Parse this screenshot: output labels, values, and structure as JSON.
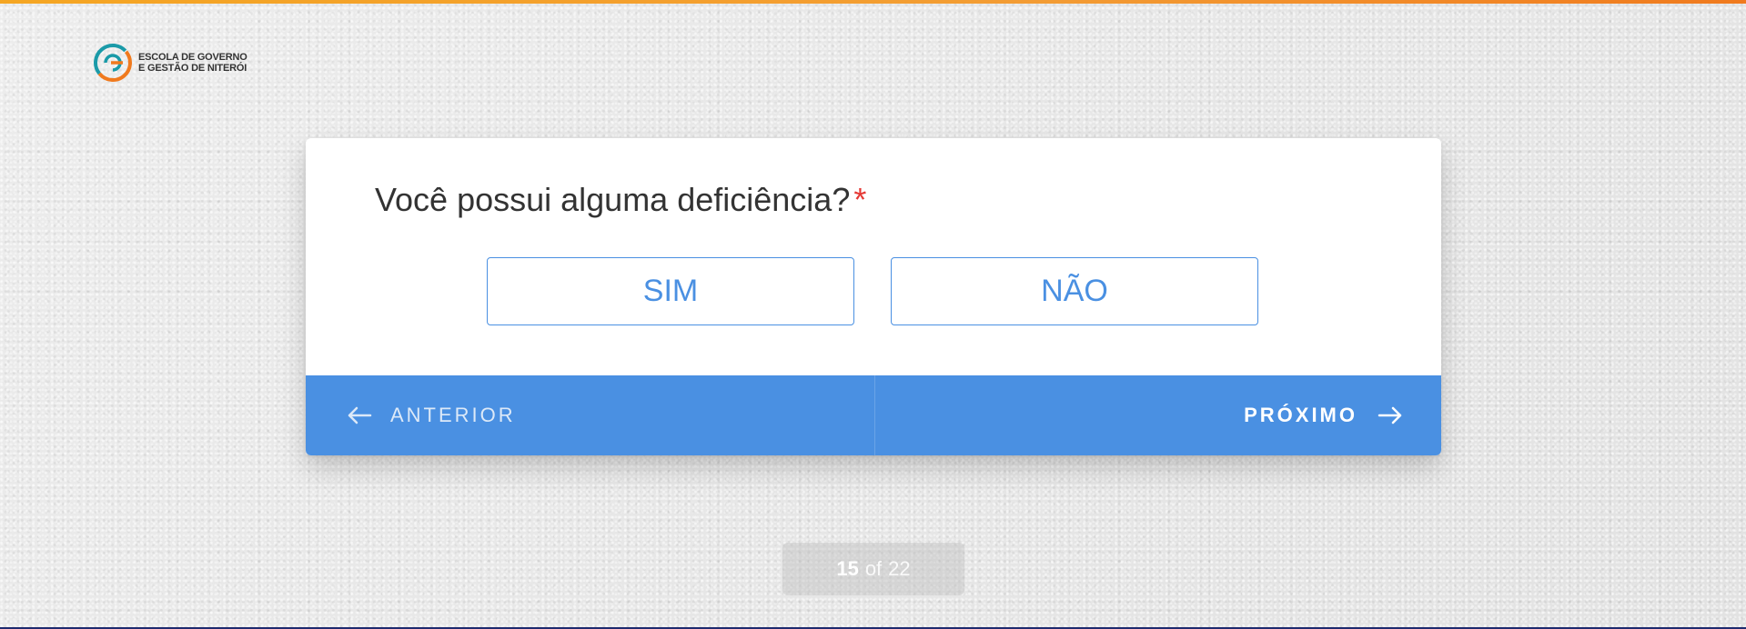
{
  "colors": {
    "accent": "#4a90e2",
    "required": "#e53935",
    "top_bar": "#f39c34",
    "bottom_bar": "#1e2a6e"
  },
  "logo": {
    "icon": "escola-governo-logo-icon",
    "line1": "ESCOLA DE GOVERNO",
    "line2": "E GESTÃO DE NITERÓI"
  },
  "question": {
    "text": "Você possui alguma deficiência?",
    "required_mark": "*"
  },
  "options": [
    {
      "label": "SIM"
    },
    {
      "label": "NÃO"
    }
  ],
  "navigation": {
    "prev_label": "ANTERIOR",
    "prev_icon": "arrow-left-icon",
    "next_label": "PRÓXIMO",
    "next_icon": "arrow-right-icon"
  },
  "pager": {
    "current": "15",
    "separator": "of",
    "total": "22"
  }
}
